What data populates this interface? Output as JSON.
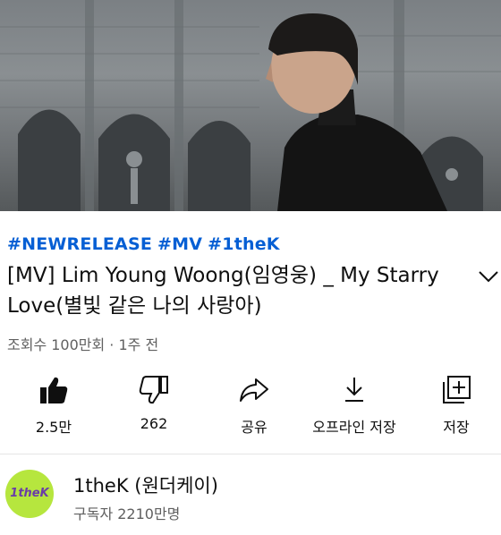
{
  "video": {
    "thumbnail_icon": "video-frame-image"
  },
  "hashtags": [
    "#NEWRELEASE",
    "#MV",
    "#1theK"
  ],
  "title_lines": [
    "[MV] Lim Young Woong(임영웅) _ My Starry",
    "Love(별빛 같은 나의 사랑아)"
  ],
  "meta": "조회수 100만회 · 1주 전",
  "actions": [
    {
      "icon": "like-icon",
      "label": "2.5만"
    },
    {
      "icon": "dislike-icon",
      "label": "262"
    },
    {
      "icon": "share-icon",
      "label": "공유"
    },
    {
      "icon": "download-icon",
      "label": "오프라인 저장"
    },
    {
      "icon": "save-to-playlist-icon",
      "label": "저장"
    }
  ],
  "channel": {
    "avatar_text": "1theK",
    "name": "1theK (원더케이)",
    "subscribers": "구독자 2210만명"
  },
  "colors": {
    "hashtag": "#065fd4",
    "avatar_bg": "#b6e63e",
    "avatar_text": "#6a3ca8"
  }
}
